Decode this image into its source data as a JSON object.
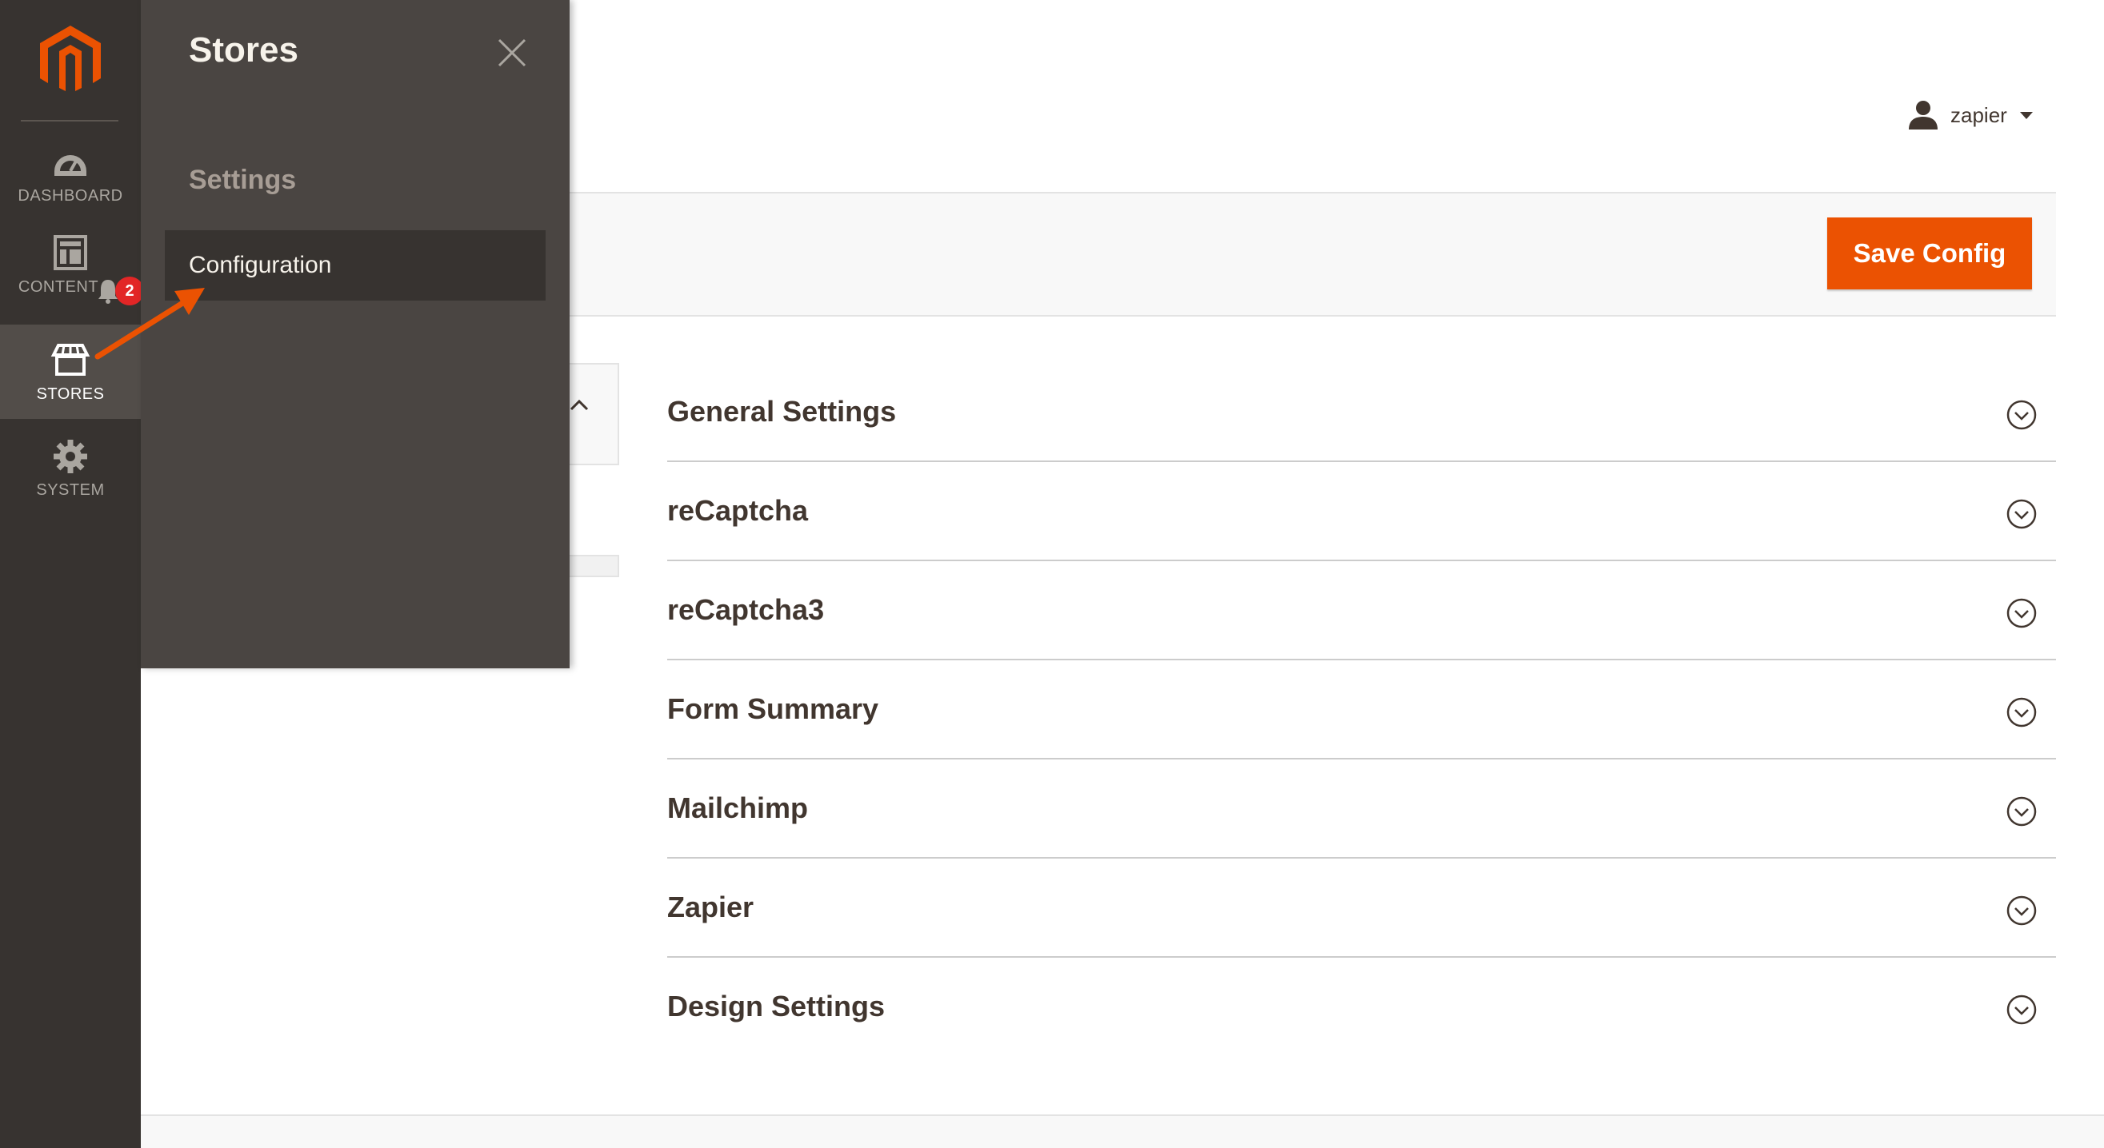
{
  "nav": {
    "items": [
      {
        "label": "DASHBOARD",
        "icon": "dashboard-icon"
      },
      {
        "label": "CONTENT",
        "icon": "content-icon"
      },
      {
        "label": "STORES",
        "icon": "stores-icon"
      },
      {
        "label": "SYSTEM",
        "icon": "gear-icon"
      }
    ],
    "notifications_count": "2"
  },
  "flyout": {
    "title": "Stores",
    "section": "Settings",
    "link": "Configuration"
  },
  "header": {
    "username": "zapier"
  },
  "actions": {
    "save_label": "Save Config"
  },
  "sections": [
    {
      "title": "General Settings"
    },
    {
      "title": "reCaptcha"
    },
    {
      "title": "reCaptcha3"
    },
    {
      "title": "Form Summary"
    },
    {
      "title": "Mailchimp"
    },
    {
      "title": "Zapier"
    },
    {
      "title": "Design Settings"
    }
  ],
  "colors": {
    "nav_bg": "#373330",
    "flyout_bg": "#4a4542",
    "accent": "#eb5202",
    "badge": "#e22626"
  }
}
